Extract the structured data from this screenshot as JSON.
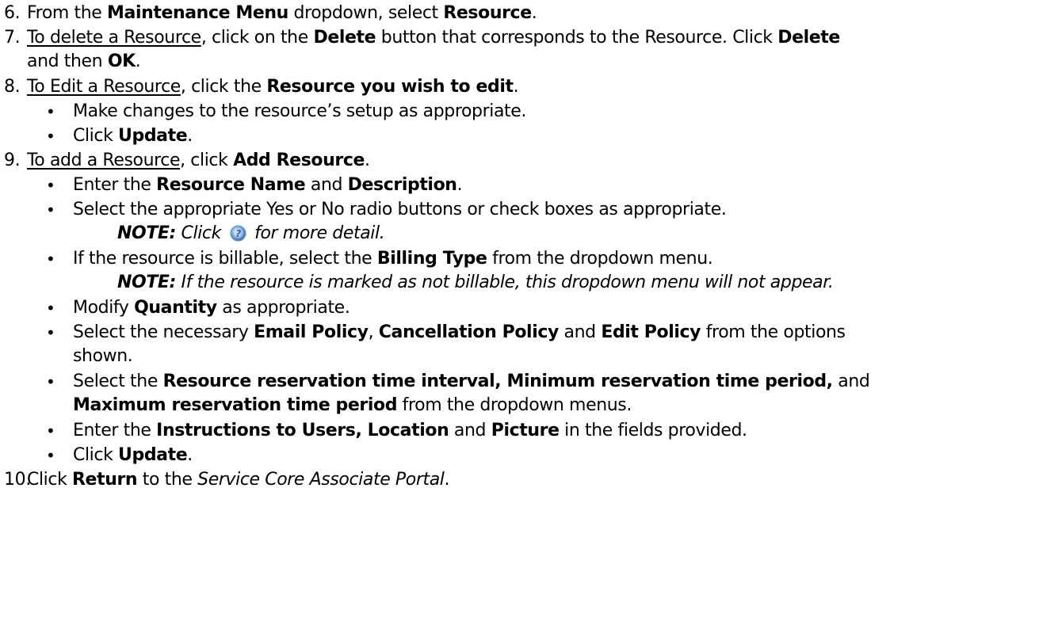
{
  "steps": {
    "s6": {
      "number": "6.",
      "t1": "From the ",
      "b1": "Maintenance Menu",
      "t2": " dropdown, select ",
      "b2": "Resource",
      "t3": "."
    },
    "s7": {
      "number": "7.",
      "u1": "To delete a Resource",
      "t1": ", click on the ",
      "b1": "Delete",
      "t2": " button that corresponds to the Resource. Click ",
      "b2": "Delete",
      "t3": "and then ",
      "b3": "OK",
      "t4": "."
    },
    "s8": {
      "number": "8.",
      "u1": "To Edit a Resource",
      "t1": ", click the ",
      "b1": "Resource you wish to edit",
      "t2": ".",
      "bullets": {
        "a": "Make changes to the resource’s setup as appropriate.",
        "b_t1": "Click ",
        "b_b1": "Update",
        "b_t2": "."
      }
    },
    "s9": {
      "number": "9.",
      "u1": "To add a Resource",
      "t1": ", click ",
      "b1": "Add Resource",
      "t2": ".",
      "bullets": {
        "a_t1": "Enter the ",
        "a_b1": "Resource Name",
        "a_t2": " and ",
        "a_b2": "Description",
        "a_t3": ".",
        "b": "Select the appropriate Yes or No radio buttons or check boxes as appropriate.",
        "b_note_label": "NOTE:",
        "b_note_t1": " Click ",
        "b_note_t2": " for more detail.",
        "c_t1": "If the resource is billable, select the ",
        "c_b1": "Billing Type",
        "c_t2": " from the dropdown menu.",
        "c_note_label": "NOTE:",
        "c_note_t1": "  If the resource is marked as not billable, this dropdown menu will not appear.",
        "d_t1": "Modify ",
        "d_b1": "Quantity",
        "d_t2": " as appropriate.",
        "e_t1": "Select the necessary ",
        "e_b1": "Email Policy",
        "e_t2": ", ",
        "e_b2": "Cancellation Policy",
        "e_t3": " and ",
        "e_b3": "Edit Policy",
        "e_t4": " from the options",
        "e_t5": "shown.",
        "f_t1": "Select the ",
        "f_b1": "Resource reservation time interval, Minimum reservation time period,",
        "f_t2": " and",
        "f_b2": "Maximum reservation time period",
        "f_t3": " from the dropdown menus.",
        "g_t1": "Enter the ",
        "g_b1": "Instructions to Users, Location",
        "g_t2": " and ",
        "g_b2": "Picture",
        "g_t3": " in the fields provided.",
        "h_t1": "Click ",
        "h_b1": "Update",
        "h_t2": "."
      }
    },
    "s10": {
      "number": "10.",
      "t1": " Click ",
      "b1": "Return",
      "t2": " to the ",
      "i1": "Service Core Associate Portal",
      "t3": "."
    }
  },
  "icons": {
    "help": "help-icon",
    "help_color": "#4a8fd6"
  },
  "bullet_char": "•"
}
